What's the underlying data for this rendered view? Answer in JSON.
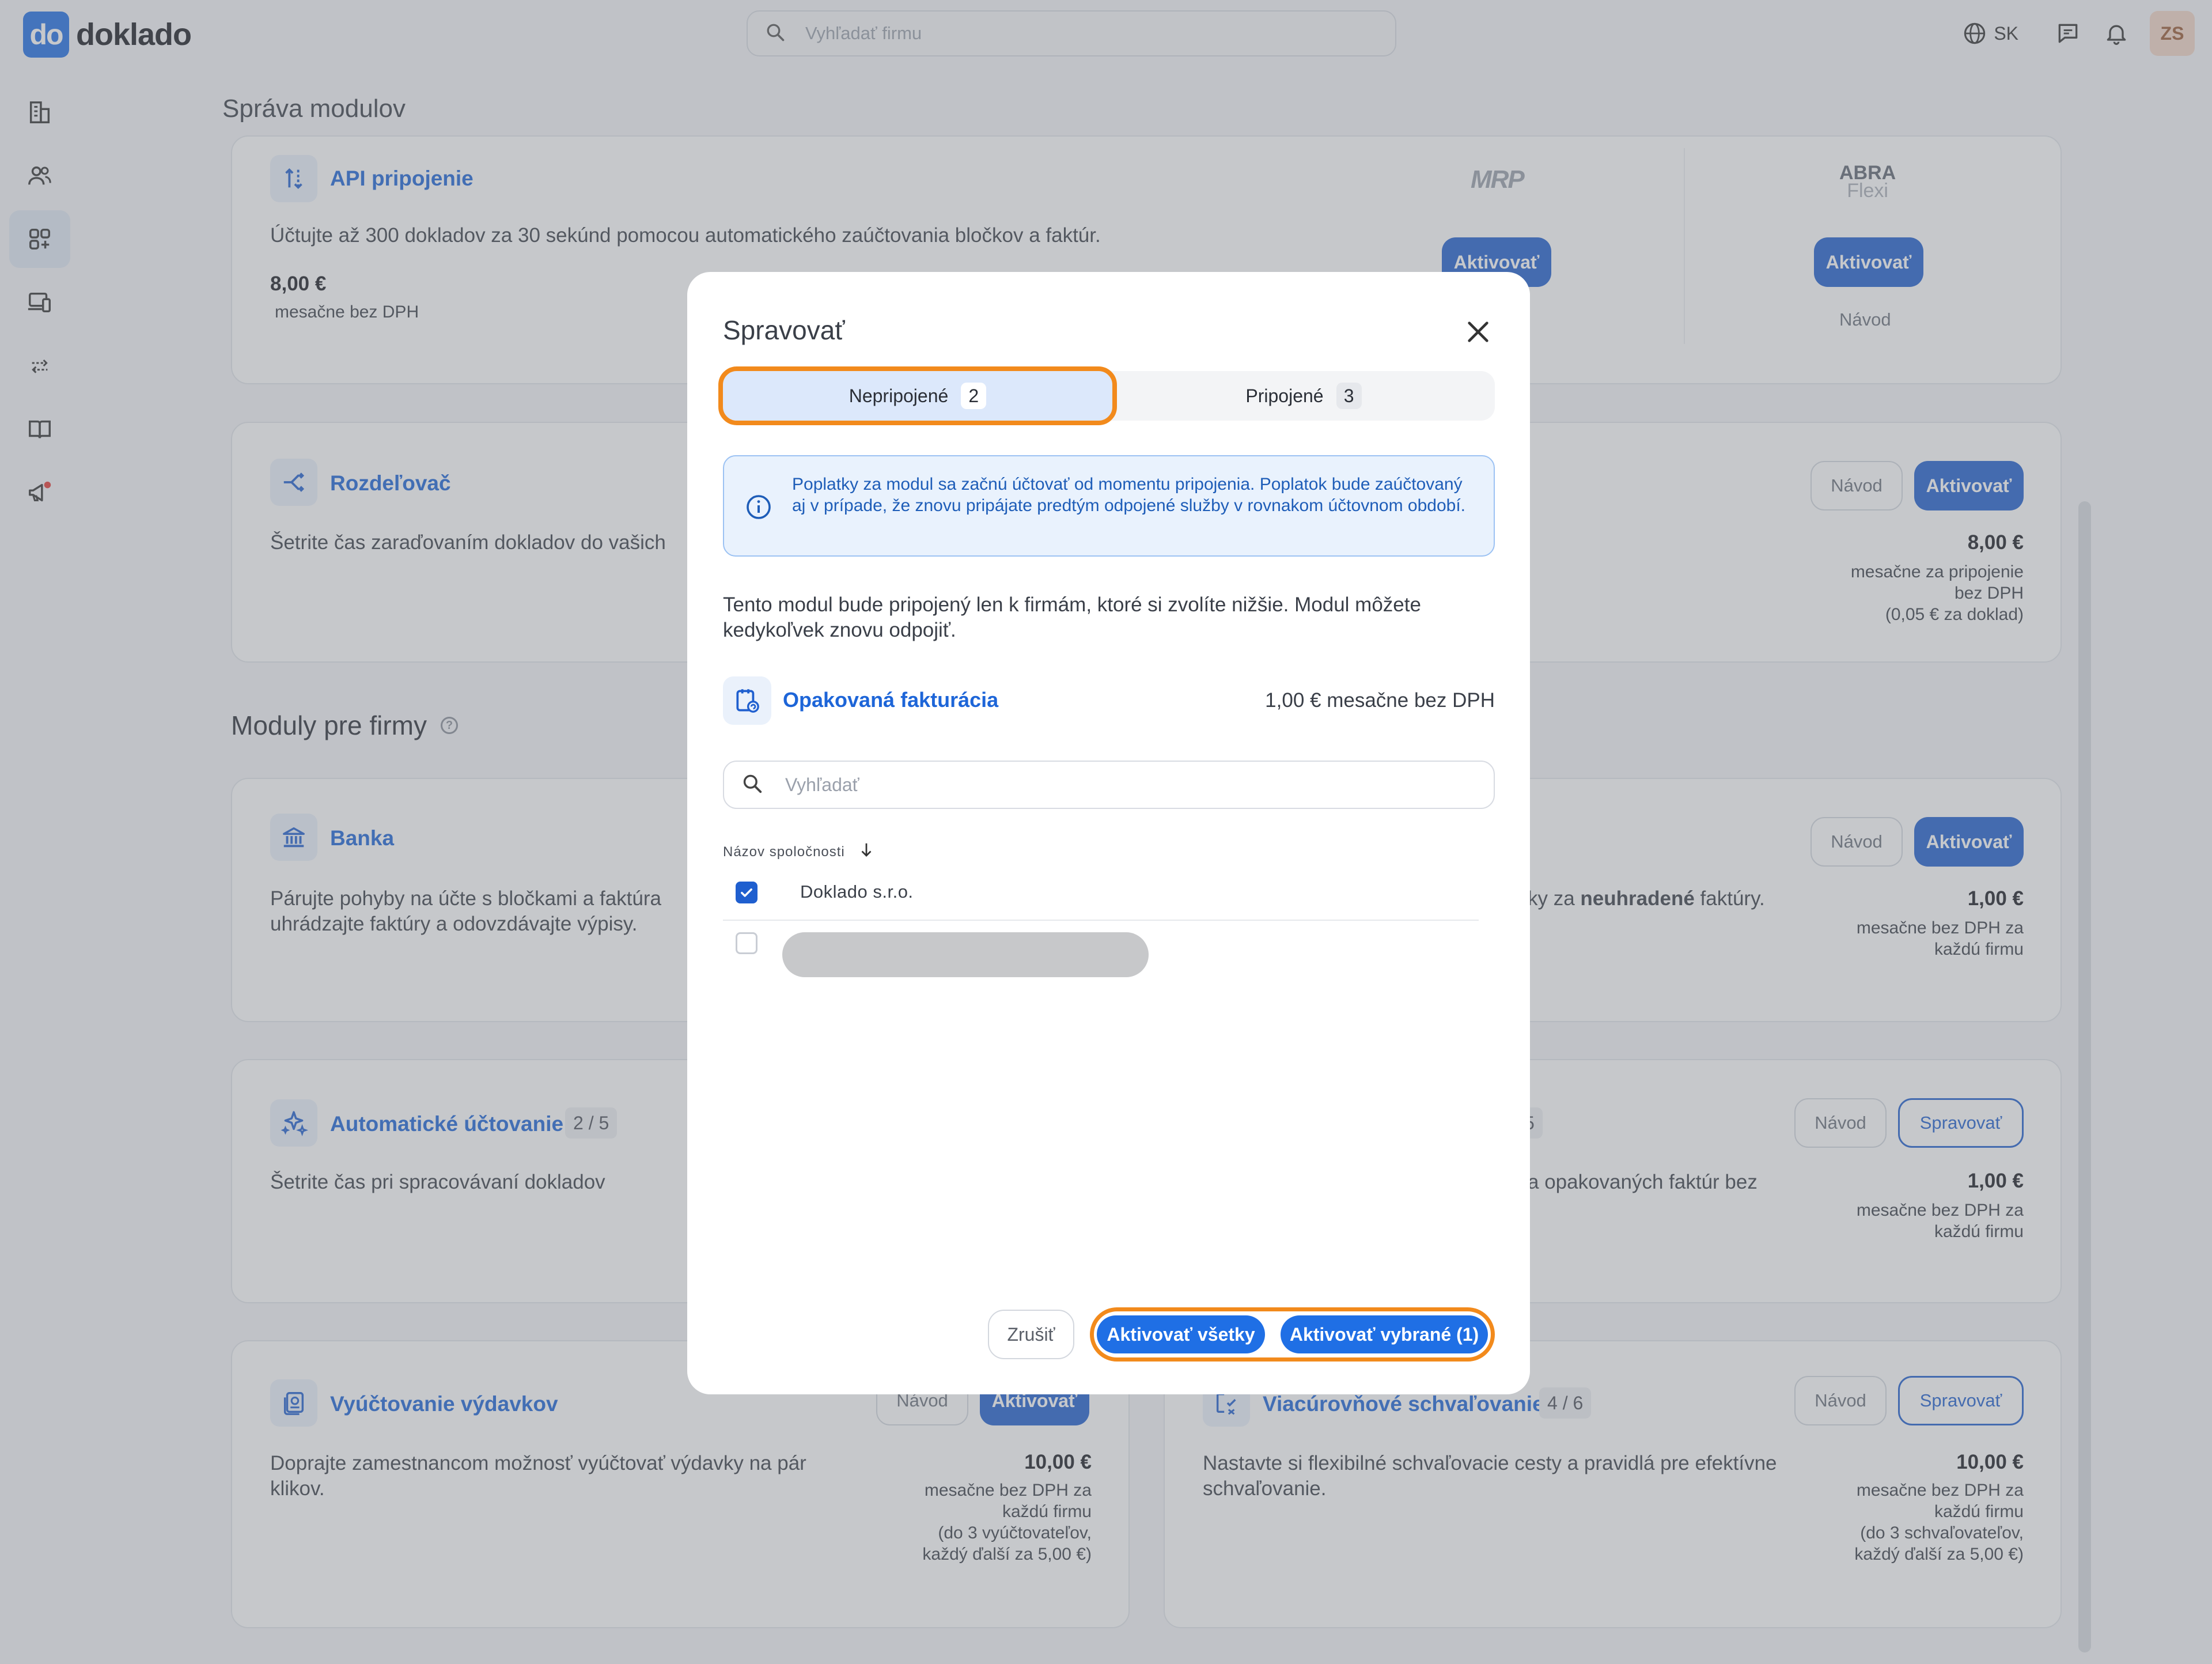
{
  "app": {
    "logo_mark": "do",
    "logo_text": "doklado"
  },
  "topbar": {
    "search_placeholder": "Vyhľadať firmu",
    "language": "SK",
    "user_initials": "ZS"
  },
  "page": {
    "title": "Správa modulov",
    "section_title": "Moduly pre firmy",
    "section_help": "?"
  },
  "cards": {
    "api": {
      "title": "API pripojenie",
      "desc": "Účtujte až 300 dokladov za 30 sekúnd pomocou automatického zaúčtovania bločkov a faktúr.",
      "price": "8,00 €",
      "price_note": "mesačne bez DPH",
      "partner1_logo": "MRP",
      "partner1_activate": "Aktivovať",
      "partner2_logo_line1": "ABRA",
      "partner2_logo_line2": "Flexi",
      "partner2_activate": "Aktivovať",
      "partner2_guide": "Návod"
    },
    "splitter": {
      "title": "Rozdeľovač",
      "desc": "Šetrite čas zaraďovaním dokladov do vašich",
      "guide": "Návod",
      "activate": "Aktivovať",
      "price": "8,00 €",
      "price_note_1": "mesačne za pripojenie",
      "price_note_2": "bez DPH",
      "price_note_3": "(0,05 € za doklad)"
    },
    "bank": {
      "title": "Banka",
      "desc_1": "Párujte pohyby na účte s bločkami a faktúra",
      "desc_2": "uhrádzajte faktúry a odovzdávajte výpisy."
    },
    "reminders": {
      "desc_prefix": "ky za ",
      "desc_bold": "neuhradené",
      "desc_suffix": " faktúry.",
      "guide": "Návod",
      "activate": "Aktivovať",
      "price": "1,00 €",
      "price_note_1": "mesačne bez DPH za",
      "price_note_2": "každú firmu"
    },
    "auto": {
      "title": "Automatické účtovanie",
      "count": "2 / 5",
      "desc": "Šetrite čas pri spracovávaní dokladov"
    },
    "recurring": {
      "count_fragment": "5",
      "desc": "a opakovaných faktúr bez",
      "guide": "Návod",
      "manage": "Spravovať",
      "price": "1,00 €",
      "price_note_1": "mesačne bez DPH za",
      "price_note_2": "každú firmu"
    },
    "expenses": {
      "title": "Vyúčtovanie výdavkov",
      "desc": "Doprajte zamestnancom možnosť vyúčtovať výdavky na pár klikov.",
      "guide": "Návod",
      "activate": "Aktivovať",
      "price": "10,00 €",
      "price_note_1": "mesačne bez DPH za",
      "price_note_2": "každú firmu",
      "price_note_3": "(do 3 vyúčtovateľov,",
      "price_note_4": "každý ďalší za 5,00 €)"
    },
    "approval": {
      "title": "Viacúrovňové schvaľovanie",
      "count": "4 / 6",
      "desc": "Nastavte si flexibilné schvaľovacie cesty a pravidlá pre efektívne schvaľovanie.",
      "guide": "Návod",
      "manage": "Spravovať",
      "price": "10,00 €",
      "price_note_1": "mesačne bez DPH za",
      "price_note_2": "každú firmu",
      "price_note_3": "(do 3 schvaľovateľov,",
      "price_note_4": "každý ďalší za 5,00 €)"
    }
  },
  "modal": {
    "title": "Spravovať",
    "tabs": [
      {
        "label": "Nepripojené",
        "count": "2"
      },
      {
        "label": "Pripojené",
        "count": "3"
      }
    ],
    "info": "Poplatky za modul sa začnú účtovať od momentu pripojenia. Poplatok bude zaúčtovaný aj v prípade, že znovu pripájate predtým odpojené služby v rovnakom účtovnom období.",
    "description": "Tento modul bude pripojený len k firmám, ktoré si zvolíte nižšie. Modul môžete kedykoľvek znovu odpojiť.",
    "module_name": "Opakovaná fakturácia",
    "module_price": "1,00 €  mesačne bez DPH",
    "search_placeholder": "Vyhľadať",
    "column_header": "Názov spoločnosti",
    "companies": [
      {
        "name": "Doklado s.r.o.",
        "checked": true
      },
      {
        "name": "",
        "checked": false
      }
    ],
    "cancel": "Zrušiť",
    "activate_all": "Aktivovať všetky",
    "activate_selected": "Aktivovať vybrané (1)"
  },
  "colors": {
    "accent": "#1f5fcf",
    "highlight": "#f28a1c",
    "overlay": "#787c84"
  }
}
